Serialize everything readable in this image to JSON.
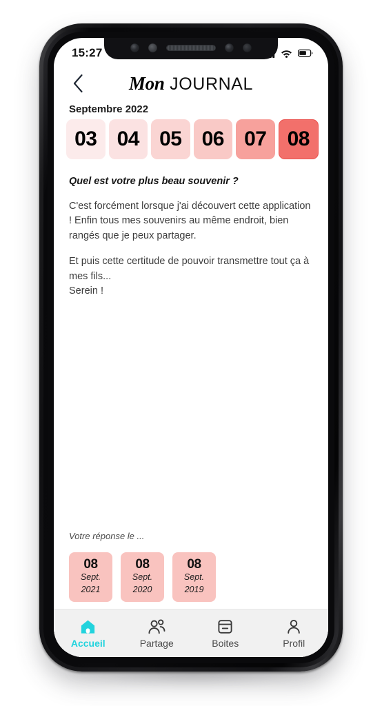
{
  "status_bar": {
    "time": "15:27",
    "icons": [
      "signal-icon",
      "wifi-icon",
      "battery-icon"
    ]
  },
  "header": {
    "back_icon": "chevron-left-icon",
    "title_accent": "Mon",
    "title_rest": " JOURNAL"
  },
  "calendar": {
    "month_label": "Septembre 2022",
    "days": [
      {
        "label": "03",
        "color": "#fcebeb",
        "selected": false
      },
      {
        "label": "04",
        "color": "#fbe2e2",
        "selected": false
      },
      {
        "label": "05",
        "color": "#fad5d3",
        "selected": false
      },
      {
        "label": "06",
        "color": "#f9c9c6",
        "selected": false
      },
      {
        "label": "07",
        "color": "#f7a19c",
        "selected": false
      },
      {
        "label": "08",
        "color": "#f2706b",
        "selected": true
      }
    ]
  },
  "entry": {
    "question": "Quel est votre plus beau souvenir ?",
    "paragraphs": [
      "C'est forcément lorsque j'ai découvert cette application ! Enfin tous mes souvenirs au même endroit, bien rangés que je peux partager.",
      "Et puis cette certitude de pouvoir transmettre tout ça à mes fils...\nSerein !"
    ]
  },
  "previous_answers": {
    "label": "Votre réponse le ...",
    "cards": [
      {
        "day": "08",
        "month": "Sept.",
        "year": "2021"
      },
      {
        "day": "08",
        "month": "Sept.",
        "year": "2020"
      },
      {
        "day": "08",
        "month": "Sept.",
        "year": "2019"
      }
    ]
  },
  "bottom_nav": {
    "active_color": "#22d3dd",
    "items": [
      {
        "label": "Accueil",
        "icon": "home-icon",
        "active": true
      },
      {
        "label": "Partage",
        "icon": "people-icon",
        "active": false
      },
      {
        "label": "Boites",
        "icon": "archive-box-icon",
        "active": false
      },
      {
        "label": "Profil",
        "icon": "person-icon",
        "active": false
      }
    ]
  }
}
